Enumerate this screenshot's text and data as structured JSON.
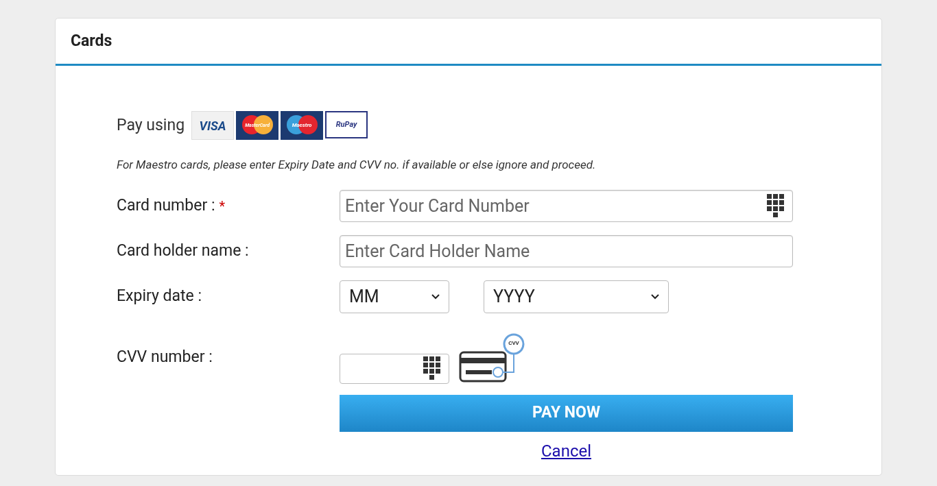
{
  "panel": {
    "title": "Cards"
  },
  "pay_using": {
    "label": "Pay using",
    "cards": [
      {
        "kind": "visa",
        "label": "VISA"
      },
      {
        "kind": "mastercard",
        "label": "MasterCard"
      },
      {
        "kind": "maestro",
        "label": "Maestro"
      },
      {
        "kind": "rupay",
        "label": "RuPay"
      }
    ]
  },
  "note": "For Maestro cards, please enter Expiry Date and CVV no. if available or else ignore and proceed.",
  "fields": [
    {
      "kind": "text",
      "label": "Card number :",
      "required_mark": "*",
      "placeholder": "Enter Your Card Number",
      "keypad": true
    },
    {
      "kind": "text",
      "label": "Card holder name :",
      "placeholder": "Enter Card Holder Name",
      "keypad": false
    },
    {
      "kind": "expiry",
      "label": "Expiry date :",
      "month": "MM",
      "year": "YYYY"
    },
    {
      "kind": "cvv",
      "label": "CVV number :",
      "keypad": true,
      "badge": "CVV"
    }
  ],
  "pay_button": "PAY NOW",
  "cancel_link": "Cancel"
}
